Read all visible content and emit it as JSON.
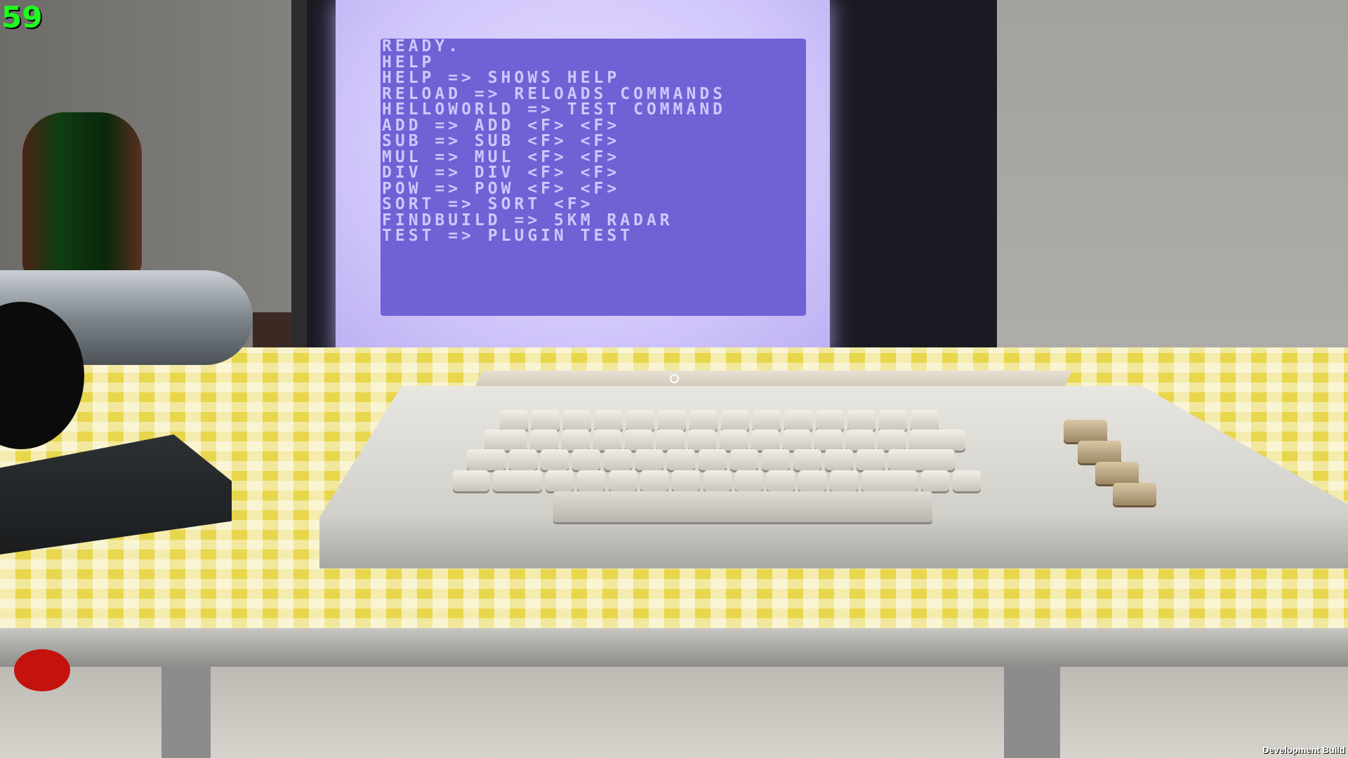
{
  "hud": {
    "fps": "59",
    "build_label": "Development Build"
  },
  "terminal": {
    "lines": [
      "READY.",
      "HELP",
      "HELP => SHOWS HELP",
      "RELOAD => RELOADS COMMANDS",
      "HELLOWORLD => TEST COMMAND",
      "ADD => ADD <F> <F>",
      "SUB => SUB <F> <F>",
      "MUL => MUL <F> <F>",
      "DIV => DIV <F> <F>",
      "POW => POW <F> <F>",
      "SORT => SORT <F>",
      "FINDBUILD => 5KM RADAR",
      "TEST => PLUGIN TEST"
    ]
  },
  "colors": {
    "terminal_bg": "#6f62d4",
    "terminal_text": "#cfc7ff",
    "screen_glow": "#d2c7fb",
    "fps_text": "#1dff1d",
    "tablecloth": "#e8d64c"
  },
  "icons": {
    "crosshair": "crosshair-icon"
  }
}
